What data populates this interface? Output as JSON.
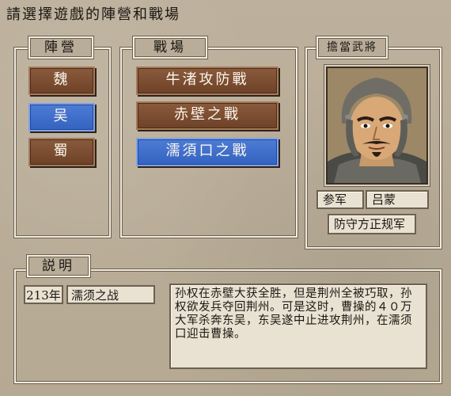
{
  "screen_title": "請選擇遊戲的陣營和戰場",
  "faction_panel": {
    "label": "陣營",
    "items": [
      {
        "label": "魏",
        "selected": false
      },
      {
        "label": "吴",
        "selected": true
      },
      {
        "label": "蜀",
        "selected": false
      }
    ]
  },
  "battlefield_panel": {
    "label": "戰場",
    "items": [
      {
        "label": "牛渚攻防戰",
        "selected": false
      },
      {
        "label": "赤壁之戰",
        "selected": false
      },
      {
        "label": "濡須口之戰",
        "selected": true
      }
    ]
  },
  "general_panel": {
    "label": "擔當武將",
    "rank": "参军",
    "name": "吕蒙",
    "unit": "防守方正规军"
  },
  "description_panel": {
    "label": "説明",
    "year": "213年",
    "battle_name": "濡须之战",
    "text": "孙权在赤壁大获全胜，但是荆州全被巧取，孙权欲发兵夺回荆州。可是这时，曹操的４０万大军杀奔东吴，东吴遂中止进攻荆州，在濡须口迎击曹操。"
  },
  "colors": {
    "selected_button": "#3f6fd0",
    "normal_button": "#7a4c31",
    "background": "#b9ad99"
  }
}
